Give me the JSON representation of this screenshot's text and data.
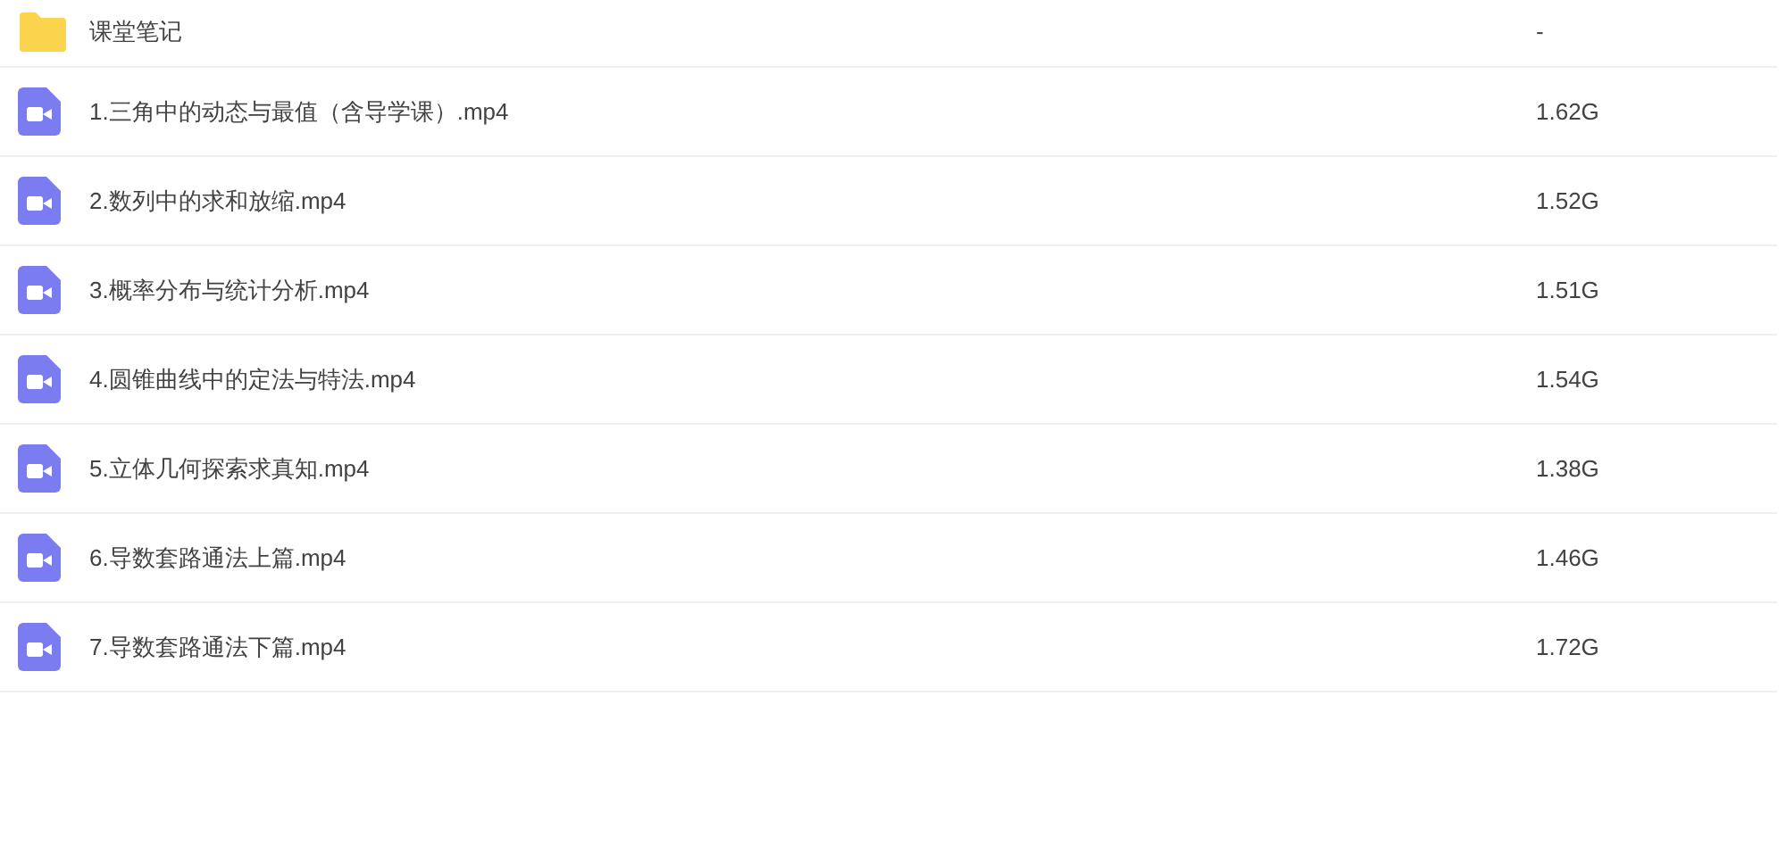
{
  "files": [
    {
      "kind": "folder",
      "name": "课堂笔记",
      "size": "-"
    },
    {
      "kind": "video",
      "name": "1.三角中的动态与最值（含导学课）.mp4",
      "size": "1.62G"
    },
    {
      "kind": "video",
      "name": "2.数列中的求和放缩.mp4",
      "size": "1.52G"
    },
    {
      "kind": "video",
      "name": "3.概率分布与统计分析.mp4",
      "size": "1.51G"
    },
    {
      "kind": "video",
      "name": "4.圆锥曲线中的定法与特法.mp4",
      "size": "1.54G"
    },
    {
      "kind": "video",
      "name": "5.立体几何探索求真知.mp4",
      "size": "1.38G"
    },
    {
      "kind": "video",
      "name": "6.导数套路通法上篇.mp4",
      "size": "1.46G"
    },
    {
      "kind": "video",
      "name": "7.导数套路通法下篇.mp4",
      "size": "1.72G"
    }
  ]
}
